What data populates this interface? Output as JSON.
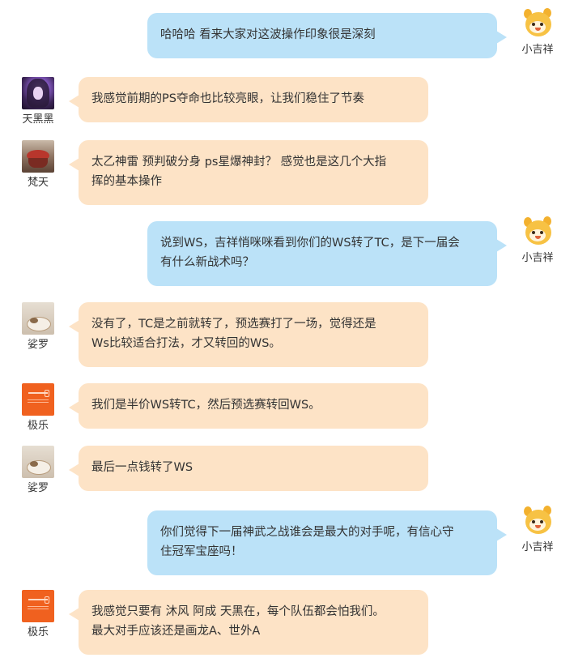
{
  "messages": [
    {
      "side": "right",
      "avatar": "chick",
      "name": "小吉祥",
      "lines": [
        "哈哈哈 看来大家对这波操作印象很是深刻"
      ]
    },
    {
      "side": "left",
      "avatar": "dark-portrait",
      "name": "天黑黑",
      "lines": [
        "我感觉前期的PS夺命也比较亮眼，让我们稳住了节奏"
      ]
    },
    {
      "side": "left",
      "avatar": "cake",
      "name": "梵天",
      "lines": [
        "太乙神雷 预判破分身 ps星爆神封？ 感觉也是这几个大指",
        "挥的基本操作"
      ]
    },
    {
      "side": "right",
      "avatar": "chick",
      "name": "小吉祥",
      "lines": [
        "说到WS，吉祥悄咪咪看到你们的WS转了TC，是下一届会",
        "有什么新战术吗？"
      ]
    },
    {
      "side": "left",
      "avatar": "cat",
      "name": "娑罗",
      "lines": [
        "没有了，TC是之前就转了，预选赛打了一场，觉得还是",
        "Ws比较适合打法，才又转回的WS。"
      ]
    },
    {
      "side": "left",
      "avatar": "orange-logo",
      "name": "极乐",
      "lines": [
        "我们是半价WS转TC，然后预选赛转回WS。"
      ]
    },
    {
      "side": "left",
      "avatar": "cat",
      "name": "娑罗",
      "lines": [
        "最后一点钱转了WS"
      ]
    },
    {
      "side": "right",
      "avatar": "chick",
      "name": "小吉祥",
      "lines": [
        "你们觉得下一届神武之战谁会是最大的对手呢，有信心守",
        "住冠军宝座吗！"
      ]
    },
    {
      "side": "left",
      "avatar": "orange-logo",
      "name": "极乐",
      "lines": [
        "我感觉只要有 沐风 阿成 天黑在，每个队伍都会怕我们。",
        "最大对手应该还是画龙A、世外A"
      ]
    }
  ]
}
